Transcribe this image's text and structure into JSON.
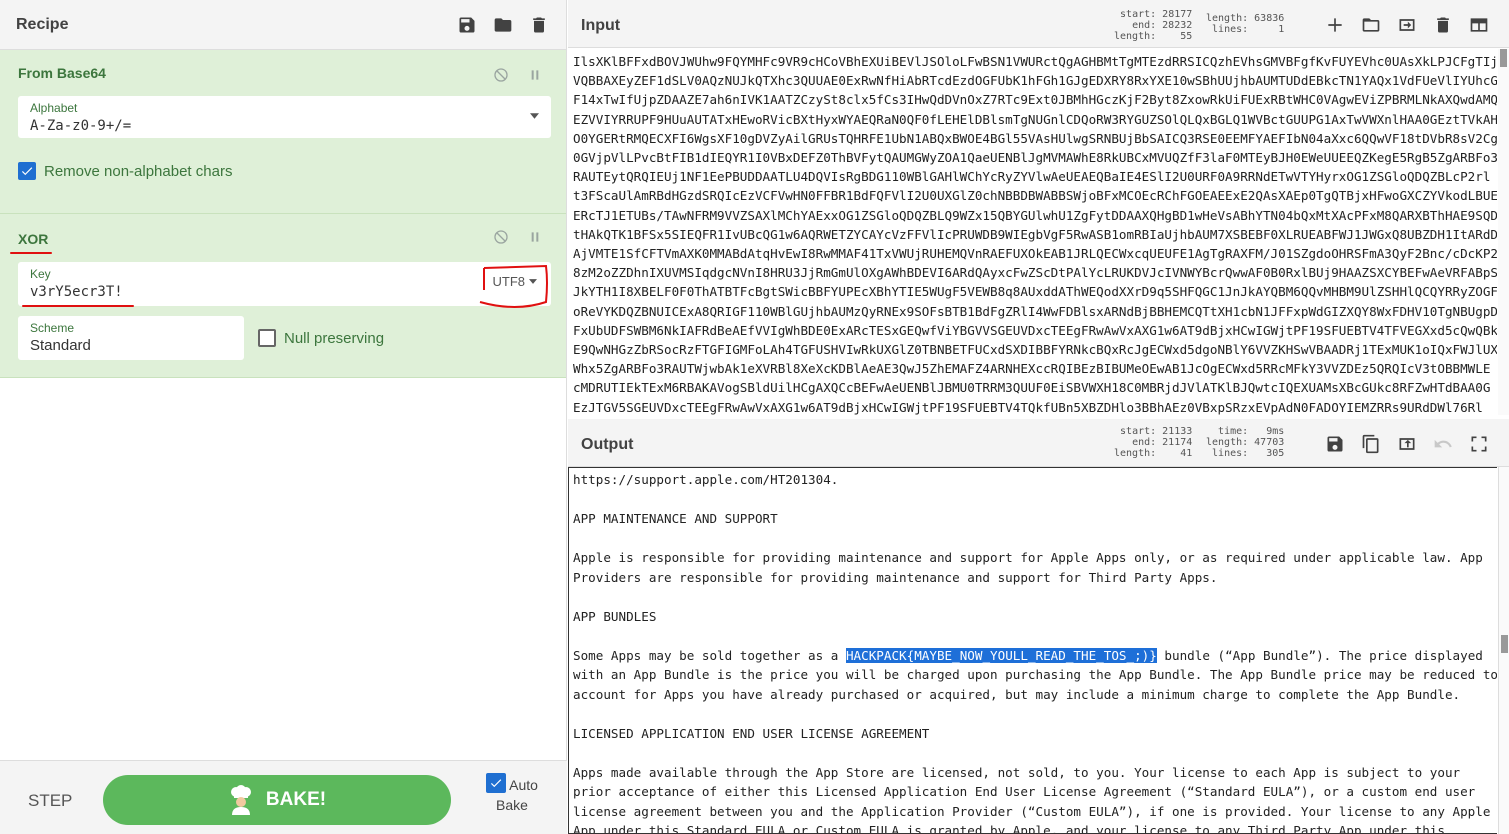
{
  "recipe": {
    "title": "Recipe",
    "operations": [
      {
        "name": "From Base64",
        "alphabet_label": "Alphabet",
        "alphabet_value": "A-Za-z0-9+/=",
        "remove_label": "Remove non-alphabet chars",
        "remove_checked": true
      },
      {
        "name": "XOR",
        "key_label": "Key",
        "key_value": "v3rY5ecr3T!",
        "key_encoding": "UTF8",
        "scheme_label": "Scheme",
        "scheme_value": "Standard",
        "null_label": "Null preserving",
        "null_checked": false
      }
    ],
    "step_label": "STEP",
    "bake_label": "BAKE!",
    "autobake_label": "Auto Bake",
    "autobake_checked": true
  },
  "input": {
    "title": "Input",
    "stats": {
      "start": "start: 28177",
      "end": "end: 28232",
      "length": "length:    55",
      "total_length": "length: 63836",
      "lines": "lines:     1"
    },
    "lines": [
      "IlsXKlBFFxdBOVJWUhw9FQYMHFc9VR9cHCoVBhEXUiBEVlJSOloLFwBSN1VWURctQgAGHBMtTgMTEzdRRSICQzhEVhsGMVBFgfKvFUYEVhc0UAsXkLPJCFgTIj",
      "VQBBAXEyZEF1dSLV0AQzNUJkQTXhc3QUUAE0ExRwNfHiAbRTcdEzdOGFUbK1hFGh1GJgEDXRY8RxYXE10wSBhUUjhbAUMTUDdEBkcTN1YAQx1VdFUeVlIYUhcG",
      "F14xTwIfUjpZDAAZE7ah6nIVK1AATZCzySt8clx5fCs3IHwQdDVnOxZ7RTc9Ext0JBMhHGczKjF2Byt8ZxowRkUiFUExRBtWHC0VAgwEViZPBRMLNkAXQwdAMQ",
      "EZVVIYRRUPF9HUuAUTATxHEwoRVicBXtHyxWYAEQRaN0QF0fLEHElDBlsmTgNUGnlCDQoRW3RYGUZSOlQLQxBGLQ1WVBctGUUPG1AxTwVWXnlHAA0GEztTVkAH",
      "O0YGERtRMQECXFI6WgsXF10gDVZyAilGRUsTQHRFE1UbN1ABQxBWOE4BGl55VAsHUlwgSRNBUjBbSAICQ3RSE0EEMFYAEFIbN04aXxc6QQwVF18tDVbR8sV2Cg",
      "0GVjpVlLPvcBtFIB1dIEQYR1I0VBxDEFZ0ThBVFytQAUMGWyZOA1QaeUENBlJgMVMAWhE8RkUBCxMVUQZfF3laF0MTEyBJH0EWeUUEEQZKegE5RgB5ZgARBFo3",
      "RAUTEytQRQIEUj1NF1EePBUDDAATLU4DQVIsRgBDG110WBlGAHlWChYcRyZYVlwAeUEAEQBaIE4ESlI2U0URF0A9RRNdETwVTYHyrxOG1ZSGloQDQZBLcP2rl",
      "t3FScaUlAmRBdHGzdSRQIcEzVCFVwHN0FFBR1BdFQFVlI2U0UXGlZ0chNBBDBWABBSWjoBFxMCOEcRChFGOEAEExE2QAsXAEp0TgQTBjxHFwoGXCZYVkodLBUE",
      "ERcTJ1ETUBs/TAwNFRM9VVZSAXlMChYAExxOG1ZSGloQDQZBLQ9WZx15QBYGUlwhU1ZgFytDDAAXQHgBD1wHeVsABhYTN04bQxMtXAcPFxM8QARXBThHAE9SQD",
      "tHAkQTK1BFSx5SIEQFR1IvUBcQG1w6AQRWETZYCAYcVzFFVlIcPRUWDB9WIEgbVgF5RwASB1omRBIaUjhbAUM7XSBEBF0XLRUEABFWJ1JWGxQ8UBZDH1ItARdD",
      "AjVMTE1SfCFTVmAXK0MMABdAtqHvEwI8RwMMAF41TxVWUjRUHEMQVnRAEFUXOkEAB1JRLQECWxcqUEUFE1AgTgRAXFM/J01SZgdoOHRSFmA3QyF2Bnc/cDcKP2",
      "8zM2oZZDhnIXUVMSIqdgcNVnI8HRU3JjRmGmUlOXgAWhBDEVI6ARdQAyxcFwZScDtPAlYcLRUKDVJcIVNWYBcrQwwAF0B0RxlBUj9HAAZSXCYBEFwAeVRFABpS",
      "JkYTH1I8XBELF0F0ThATBTFcBgtSWicBBFYUPEcXBhYTIE5WUgF5VEWB8q8AUxddAThWEQodXXrD9q5SHFQGC1JnJkAYQBM6QQvMHBM9UlZSHHlQCQYRRyZOGF",
      "oReVYKDQZBNUICExA8QRIGF110WBlGUjhbAUMzQyRNEx9SOFsBTB1BdFgZRlI4WwFDBlsxARNdBjBBHEMCQTtXH1cbN1JFFxpWdGIZXQY8WxFDHV10TgNBUgpD",
      "FxUbUDFSWBM6NkIAFRdBeAEfVVIgWhBDE0ExARcTESxGEQwfViYBGVVSGEUVDxcTEEgFRwAwVxAXG1w6AT9dBjxHCwIGWjtPF19SFUEBTV4TFVEGXxd5cQwQBk",
      "E9QwNHGzZbRSocRzFTGFIGMFoLAh4TGFUSHVIwRkUXGlZ0TBNBETFUCxdSXDIBBFYRNkcBQxRcJgECWxd5dgoNBlY6VVZKHSwVBAADRj1TExMUK1oIQxFWJlUX",
      "Whx5ZgARBFo3RAUTWjwbAk1eXVRBl8XeXcKDBlAeAE3QwJ5ZhEMAFZ4ARNHEXccRQIBEzBIBUMeOEwAB1JcOgECWxd5RRcMFkY3VVZDEz5QRQIcV3tOBBMWLE",
      "cMDRUTIEkTExM6RBAKAVogSBldUilHCgAXQCcBEFwAeUENBlJBMU0TRRM3QUUF0EiSBVWXH18C0MBRjdJVlATKlBJQwtcIQEXUAMsXBcGUkc8RFZwHTdBAA0G",
      "EzJTGV5SGEUVDxcTEEgFRwAwVxAXG1w6AT9dBjxHCwIGWjtPF19SFUEBTV4TQkfUBn5XBZDHlo3BBhAEz0VBxpSRzxEVpAdN0FADOYIEMZRRs9URdDWl76Rl"
    ],
    "icons": [
      "plus-icon",
      "folder-icon",
      "import-icon",
      "trash-icon",
      "layout-icon"
    ]
  },
  "output": {
    "title": "Output",
    "stats": {
      "start": "start: 21133",
      "end": "end: 21174",
      "length": "length:    41",
      "time": "time:   9ms",
      "total_length": "length: 47703",
      "lines": "lines:   305"
    },
    "paragraphs": [
      [
        "https://support.apple.com/HT201304."
      ],
      [
        "APP MAINTENANCE AND SUPPORT"
      ],
      [
        "Apple is responsible for providing maintenance and support for Apple Apps only, or as required under applicable law. App",
        "Providers are responsible for providing maintenance and support for Third Party Apps."
      ],
      [
        "APP BUNDLES"
      ],
      [
        "__HL__",
        "with an App Bundle is the price you will be charged upon purchasing the App Bundle. The App Bundle price may be reduced to",
        "account for Apps you have already purchased or acquired, but may include a minimum charge to complete the App Bundle."
      ],
      [
        "LICENSED APPLICATION END USER LICENSE AGREEMENT"
      ],
      [
        "Apps made available through the App Store are licensed, not sold, to you. Your license to each App is subject to your",
        "prior acceptance of either this Licensed Application End User License Agreement (“Standard EULA”), or a custom end user",
        "license agreement between you and the Application Provider (“Custom EULA”), if one is provided. Your license to any Apple",
        "App under this Standard EULA or Custom EULA is granted by Apple, and your license to any Third Party App under this"
      ]
    ],
    "highlight_line": {
      "before": "Some Apps may be sold together as a ",
      "selected": "HACKPACK{MAYBE_NOW_YOULL_READ_THE_TOS_;)}",
      "after": " bundle (“App Bundle”). The price displayed"
    },
    "icons": [
      "save-icon",
      "copy-icon",
      "replace-input-icon",
      "undo-icon",
      "fullscreen-icon"
    ]
  },
  "colors": {
    "operation_bg": "#dff0d8",
    "operation_text": "#3c763d",
    "bake_button": "#5cb85c",
    "selection": "#1e6fd8",
    "annotation_red": "#e01010"
  }
}
